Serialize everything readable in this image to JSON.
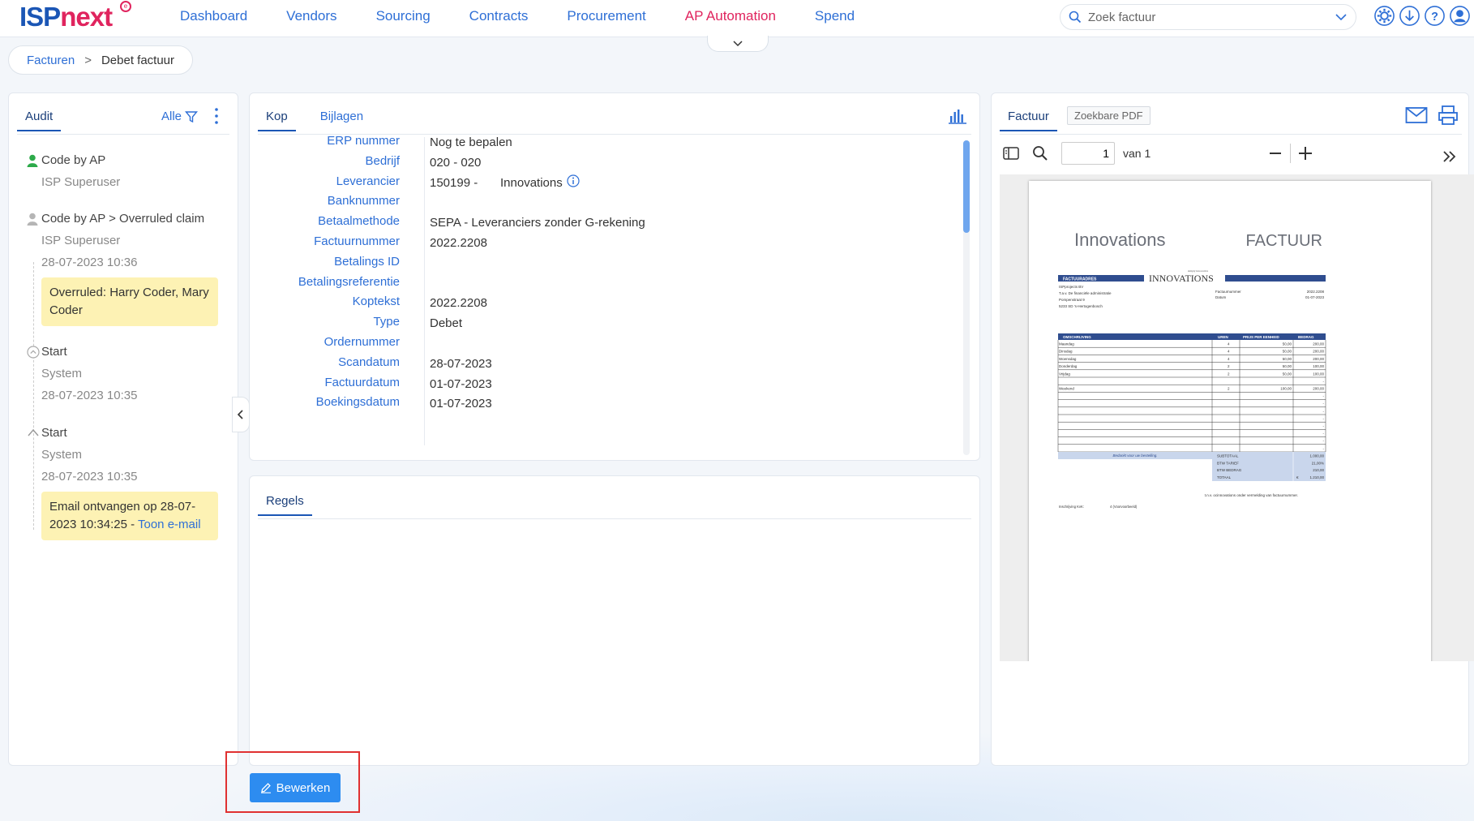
{
  "app": {
    "logo_primary": "ISP",
    "logo_secondary": "next",
    "logo_badge": "e"
  },
  "nav": {
    "items": [
      {
        "label": "Dashboard"
      },
      {
        "label": "Vendors"
      },
      {
        "label": "Sourcing"
      },
      {
        "label": "Contracts"
      },
      {
        "label": "Procurement"
      },
      {
        "label": "AP Automation",
        "active": true
      },
      {
        "label": "Spend"
      }
    ],
    "search_placeholder": "Zoek factuur"
  },
  "breadcrumb": {
    "parent": "Facturen",
    "separator": ">",
    "current": "Debet factuur"
  },
  "audit": {
    "tab": "Audit",
    "filter_label": "Alle",
    "entries": [
      {
        "title": "Code by AP",
        "user": "ISP Superuser",
        "icon": "user-icon"
      },
      {
        "title": "Code by AP > Overruled claim",
        "user": "ISP Superuser",
        "date": "28-07-2023 10:36",
        "note": "Overruled: Harry Coder, Mary Coder",
        "icon": "user-icon"
      },
      {
        "title": "Start",
        "user": "System",
        "date": "28-07-2023 10:35",
        "icon": "chevron-circle-icon"
      },
      {
        "title": "Start",
        "user": "System",
        "date": "28-07-2023 10:35",
        "note_prefix": "Email ontvangen op 28-07-2023 10:34:25 -",
        "note_link": "Toon e-mail",
        "icon": "chevron-up-icon"
      }
    ]
  },
  "kop": {
    "tabs": [
      "Kop",
      "Bijlagen"
    ],
    "fields": [
      {
        "label": "ERP nummer",
        "value": "Nog te bepalen"
      },
      {
        "label": "Bedrijf",
        "value": "020 - 020"
      },
      {
        "label": "Leverancier",
        "value": "150199 -",
        "extra": "Innovations"
      },
      {
        "label": "Banknummer",
        "value": ""
      },
      {
        "label": "Betaalmethode",
        "value": "SEPA - Leveranciers zonder G-rekening"
      },
      {
        "label": "Factuurnummer",
        "value": "2022.2208"
      },
      {
        "label": "Betalings ID",
        "value": ""
      },
      {
        "label": "Betalingsreferentie",
        "value": ""
      },
      {
        "label": "Koptekst",
        "value": "2022.2208"
      },
      {
        "label": "Type",
        "value": "Debet"
      },
      {
        "label": "Ordernummer",
        "value": ""
      },
      {
        "label": "Scandatum",
        "value": "28-07-2023"
      },
      {
        "label": "Factuurdatum",
        "value": "01-07-2023"
      },
      {
        "label": "Boekingsdatum",
        "value": "01-07-2023"
      }
    ]
  },
  "regels": {
    "tab": "Regels"
  },
  "factuur": {
    "tabs": [
      "Factuur",
      "Zoekbare PDF"
    ],
    "page_current": "1",
    "page_of": "van 1",
    "doc": {
      "company": "Innovations",
      "heading": "FACTUUR",
      "address_header": "FACTUURADRES",
      "logo_text": "INNOVATIONS",
      "logo_tagline": "simply innovative",
      "address_lines": [
        "ISPprojects BV",
        "T.a.v. De financiële administratie",
        "Pompenstraat 9",
        "5233 SD 's-Hertogenbosch"
      ],
      "meta": [
        {
          "label": "Factuurnummer",
          "value": "2022.2208"
        },
        {
          "label": "Datum",
          "value": "01-07-2023"
        }
      ],
      "table_headers": [
        "OMSCHRIJVING",
        "UREN",
        "PRIJS PER EENHEID",
        "BEDRAG"
      ],
      "rows": [
        [
          "Maandag",
          "4",
          "50,00",
          "200,00"
        ],
        [
          "Dinsdag",
          "4",
          "50,00",
          "200,00"
        ],
        [
          "Woensdag",
          "4",
          "50,00",
          "200,00"
        ],
        [
          "Donderdag",
          "2",
          "50,00",
          "100,00"
        ],
        [
          "Vrijdag",
          "2",
          "50,00",
          "100,00"
        ],
        [
          "",
          "",
          "",
          "-"
        ],
        [
          "Weekend",
          "2",
          "100,00",
          "200,00"
        ],
        [
          "",
          "",
          "",
          "-"
        ],
        [
          "",
          "",
          "",
          "-"
        ],
        [
          "",
          "",
          "",
          "-"
        ],
        [
          "",
          "",
          "",
          "-"
        ],
        [
          "",
          "",
          "",
          "-"
        ],
        [
          "",
          "",
          "",
          "-"
        ],
        [
          "",
          "",
          "",
          "-"
        ],
        [
          "",
          "",
          "",
          "-"
        ]
      ],
      "thanks": "Bedankt voor uw bestelling.",
      "totals": [
        {
          "label": "SUBTOTAAL",
          "value": "1.000,00"
        },
        {
          "label": "BTW TARIEF",
          "value": "21,00%"
        },
        {
          "label": "BTW BEDRAG",
          "value": "210,00"
        },
        {
          "label": "TOTAAL",
          "currency": "€",
          "value": "1.210,00"
        }
      ],
      "footer_note": "t.n.v. ocinnovations onder vermelding van factuurnummer.",
      "kvk_label": "Inschrijving KvK:",
      "kvk_value": "4 (Voorvoorbeeld)"
    }
  },
  "actions": {
    "edit_label": "Bewerken"
  },
  "colors": {
    "brand_blue": "#1b56b5",
    "brand_pink": "#e0245e",
    "link": "#2e6fd6",
    "primary_button": "#2d8cf0",
    "note_yellow": "#fdf2b4",
    "highlight_red": "#e03131"
  }
}
